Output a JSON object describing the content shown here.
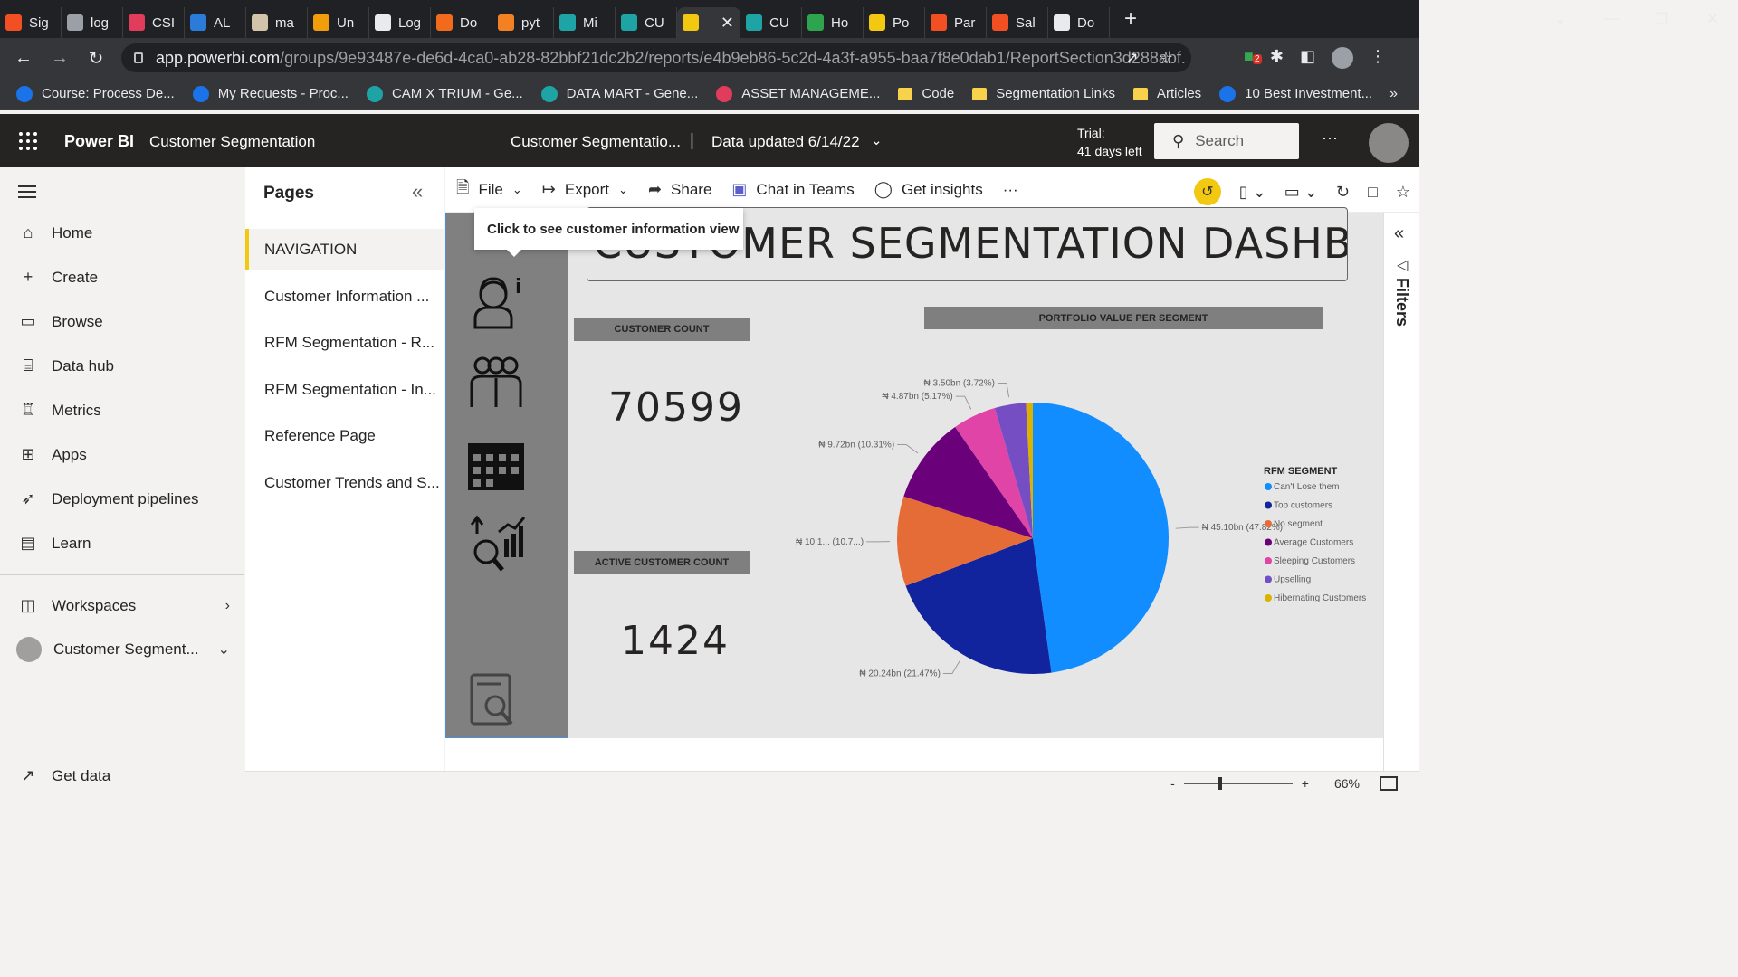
{
  "browser": {
    "tabs": [
      {
        "label": "Sig",
        "color": "#f25022"
      },
      {
        "label": "log",
        "color": "#9aa0a6"
      },
      {
        "label": "CSI",
        "color": "#e23c5c"
      },
      {
        "label": "AL",
        "color": "#2b7bd8"
      },
      {
        "label": "ma",
        "color": "#d1c4a8"
      },
      {
        "label": "Un",
        "color": "#f29d0a"
      },
      {
        "label": "Log",
        "color": "#e8eaed"
      },
      {
        "label": "Do",
        "color": "#f26b1d"
      },
      {
        "label": "pyt",
        "color": "#f48024"
      },
      {
        "label": "Mi",
        "color": "#1fa4a6"
      },
      {
        "label": "CU",
        "color": "#1fa4a6"
      },
      {
        "label": "",
        "color": "#f2c811",
        "active": true
      },
      {
        "label": "CU",
        "color": "#1fa4a6"
      },
      {
        "label": "Ho",
        "color": "#2ea44f"
      },
      {
        "label": "Po",
        "color": "#f2c811"
      },
      {
        "label": "Par",
        "color": "#f25022"
      },
      {
        "label": "Sal",
        "color": "#f25022"
      },
      {
        "label": "Do",
        "color": "#e8eaed"
      }
    ],
    "url_host": "app.powerbi.com",
    "url_path": "/groups/9e93487e-de6d-4ca0-ab28-82bbf21dc2b2/reports/e4b9eb86-5c2d-4a3f-a955-baa7f8e0dab1/ReportSection3d288abf...",
    "bookmarks": [
      {
        "label": "Course: Process De...",
        "color": "#1a73e8",
        "type": "site"
      },
      {
        "label": "My Requests - Proc...",
        "color": "#1a73e8",
        "type": "site"
      },
      {
        "label": "CAM X TRIUM - Ge...",
        "color": "#1fa4a6",
        "type": "site"
      },
      {
        "label": "DATA MART - Gene...",
        "color": "#1fa4a6",
        "type": "site"
      },
      {
        "label": "ASSET MANAGEME...",
        "color": "#e23c5c",
        "type": "site"
      },
      {
        "label": "Code",
        "type": "folder"
      },
      {
        "label": "Segmentation Links",
        "type": "folder"
      },
      {
        "label": "Articles",
        "type": "folder"
      },
      {
        "label": "10 Best Investment...",
        "color": "#1a73e8",
        "type": "site"
      }
    ],
    "extension_badge": "2"
  },
  "header": {
    "brand": "Power BI",
    "workspace": "Customer Segmentation",
    "report_name": "Customer Segmentatio...",
    "separator": "|",
    "data_updated": "Data updated 6/14/22",
    "trial_line1": "Trial:",
    "trial_line2": "41 days left",
    "search_placeholder": "Search",
    "more": "···"
  },
  "leftnav": {
    "items": [
      {
        "label": "Home",
        "icon": "home-icon",
        "glyph": "⌂"
      },
      {
        "label": "Create",
        "icon": "plus-icon",
        "glyph": "+"
      },
      {
        "label": "Browse",
        "icon": "folder-icon",
        "glyph": "▭"
      },
      {
        "label": "Data hub",
        "icon": "database-icon",
        "glyph": "⌸"
      },
      {
        "label": "Metrics",
        "icon": "trophy-icon",
        "glyph": "♖"
      },
      {
        "label": "Apps",
        "icon": "apps-icon",
        "glyph": "⊞"
      },
      {
        "label": "Deployment pipelines",
        "icon": "rocket-icon",
        "glyph": "➶"
      },
      {
        "label": "Learn",
        "icon": "book-icon",
        "glyph": "▤"
      }
    ],
    "workspaces_label": "Workspaces",
    "current_workspace": "Customer Segment...",
    "get_data": "Get data"
  },
  "pages": {
    "title": "Pages",
    "items": [
      {
        "label": "NAVIGATION",
        "selected": true
      },
      {
        "label": "Customer Information ..."
      },
      {
        "label": "RFM Segmentation - R..."
      },
      {
        "label": "RFM Segmentation - In..."
      },
      {
        "label": "Reference Page"
      },
      {
        "label": "Customer Trends and S..."
      }
    ]
  },
  "actionbar": {
    "file": "File",
    "export": "Export",
    "share": "Share",
    "chat": "Chat in Teams",
    "insights": "Get insights",
    "more": "···"
  },
  "report": {
    "title": "CUSTOMER SEGMENTATION DASHBOARD",
    "tooltip": "Click to see customer information view",
    "customer_count_label": "CUSTOMER COUNT",
    "customer_count": "70599",
    "active_count_label": "ACTIVE CUSTOMER COUNT",
    "active_count": "1424",
    "pie_title": "PORTFOLIO VALUE PER SEGMENT",
    "legend_title": "RFM SEGMENT"
  },
  "chart_data": {
    "type": "pie",
    "title": "PORTFOLIO VALUE PER SEGMENT",
    "legend_title": "RFM SEGMENT",
    "slices": [
      {
        "name": "Can't Lose them",
        "value": 45.1,
        "percent": 47.82,
        "label": "₦ 45.10bn (47.82%)",
        "color": "#118dff"
      },
      {
        "name": "Top customers",
        "value": 20.24,
        "percent": 21.47,
        "label": "₦ 20.24bn (21.47%)",
        "color": "#12239e"
      },
      {
        "name": "No segment",
        "value": 10.1,
        "percent": 10.7,
        "label": "₦ 10.1... (10.7...)",
        "color": "#e66c37"
      },
      {
        "name": "Average Customers",
        "value": 9.72,
        "percent": 10.31,
        "label": "₦ 9.72bn (10.31%)",
        "color": "#6b007b"
      },
      {
        "name": "Sleeping Customers",
        "value": 4.87,
        "percent": 5.17,
        "label": "₦ 4.87bn (5.17%)",
        "color": "#e044a7"
      },
      {
        "name": "Upselling",
        "value": 3.5,
        "percent": 3.72,
        "label": "₦ 3.50bn (3.72%)",
        "color": "#744ec2"
      },
      {
        "name": "Hibernating Customers",
        "value": 0.8,
        "percent": 0.81,
        "label": "",
        "color": "#d9b300"
      }
    ]
  },
  "filters": {
    "label": "Filters"
  },
  "status": {
    "zoom_minus": "-",
    "zoom_plus": "+",
    "zoom": 66,
    "zoom_label": "66%"
  }
}
